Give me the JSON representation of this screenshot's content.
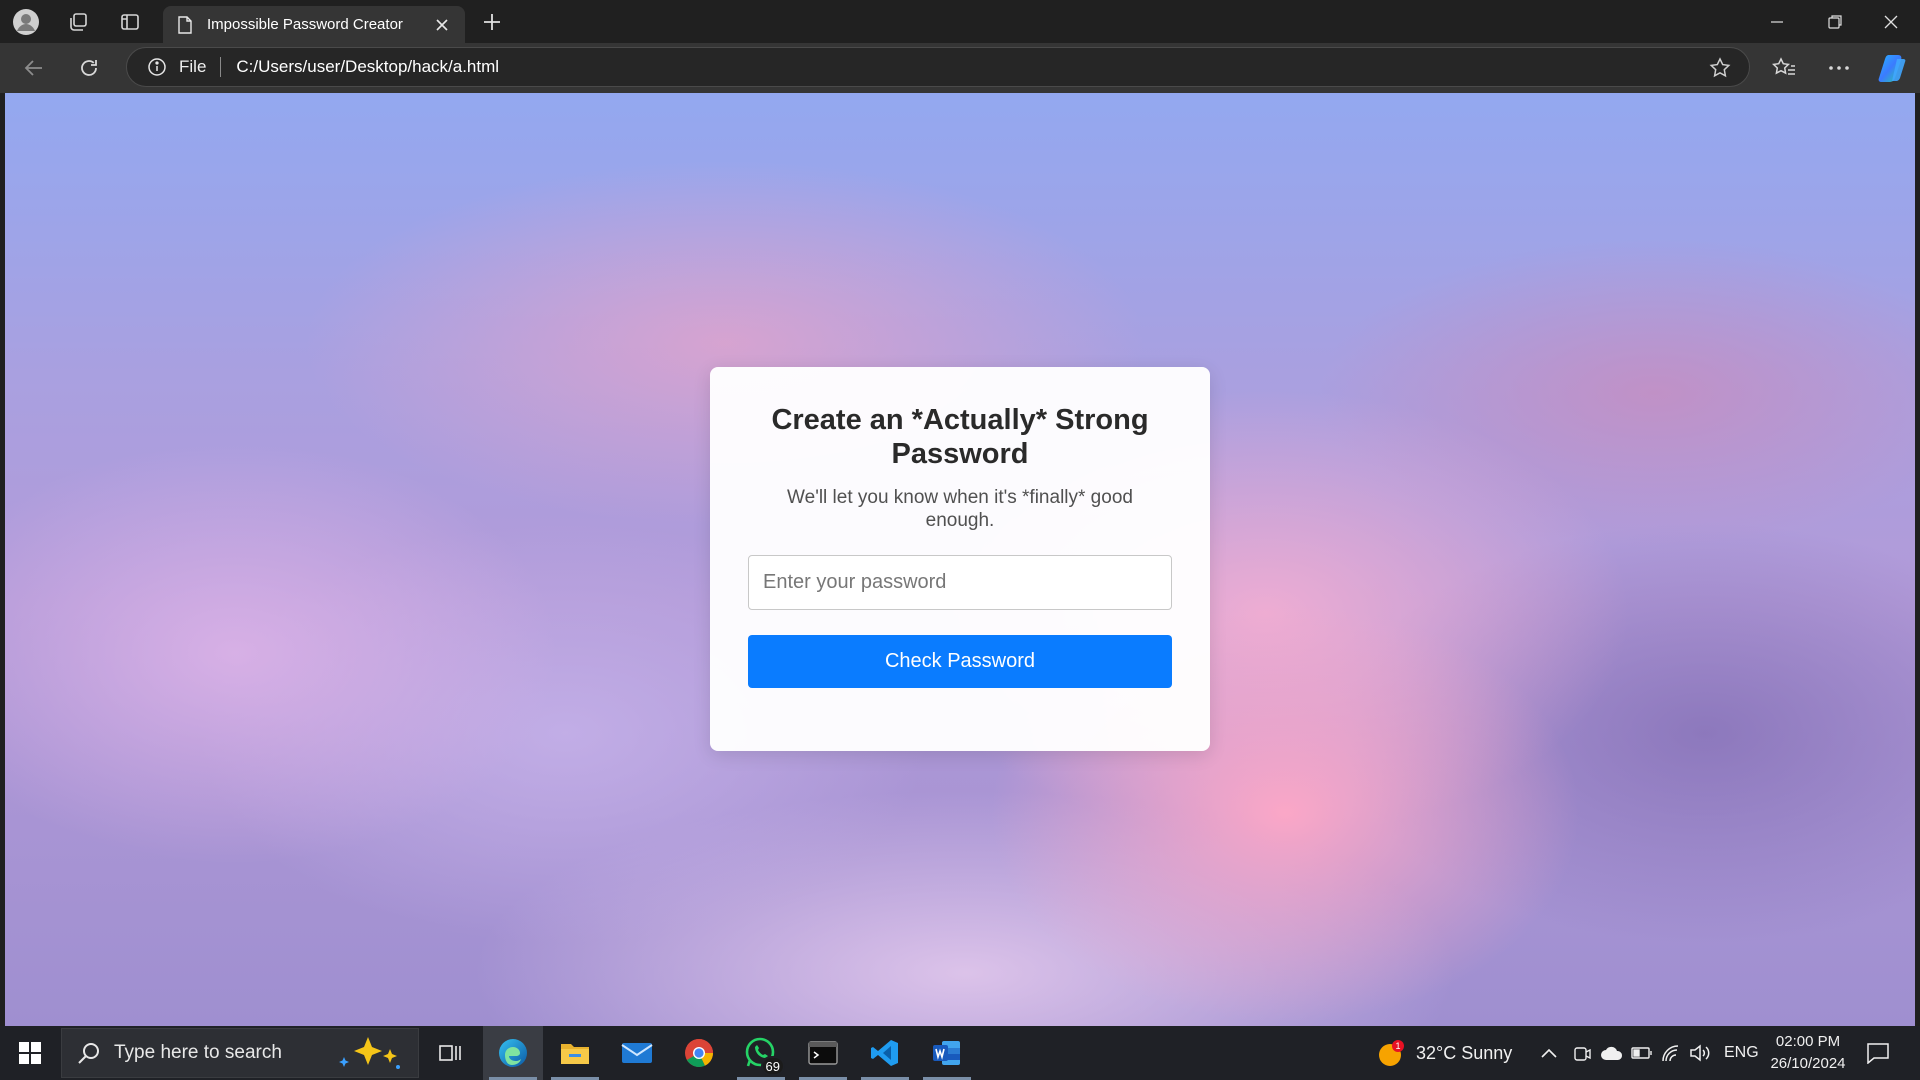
{
  "browser": {
    "tab_title": "Impossible Password Creator",
    "address_scheme_label": "File",
    "url": "C:/Users/user/Desktop/hack/a.html"
  },
  "page": {
    "heading": "Create an *Actually* Strong Password",
    "subheading": "We'll let you know when it's *finally* good enough.",
    "password_placeholder": "Enter your password",
    "check_button": "Check Password",
    "accent_color": "#0a7cff"
  },
  "taskbar": {
    "search_placeholder": "Type here to search",
    "whatsapp_badge": "69",
    "weather_badge": "1",
    "weather": "32°C  Sunny",
    "language": "ENG",
    "time": "02:00 PM",
    "date": "26/10/2024"
  }
}
